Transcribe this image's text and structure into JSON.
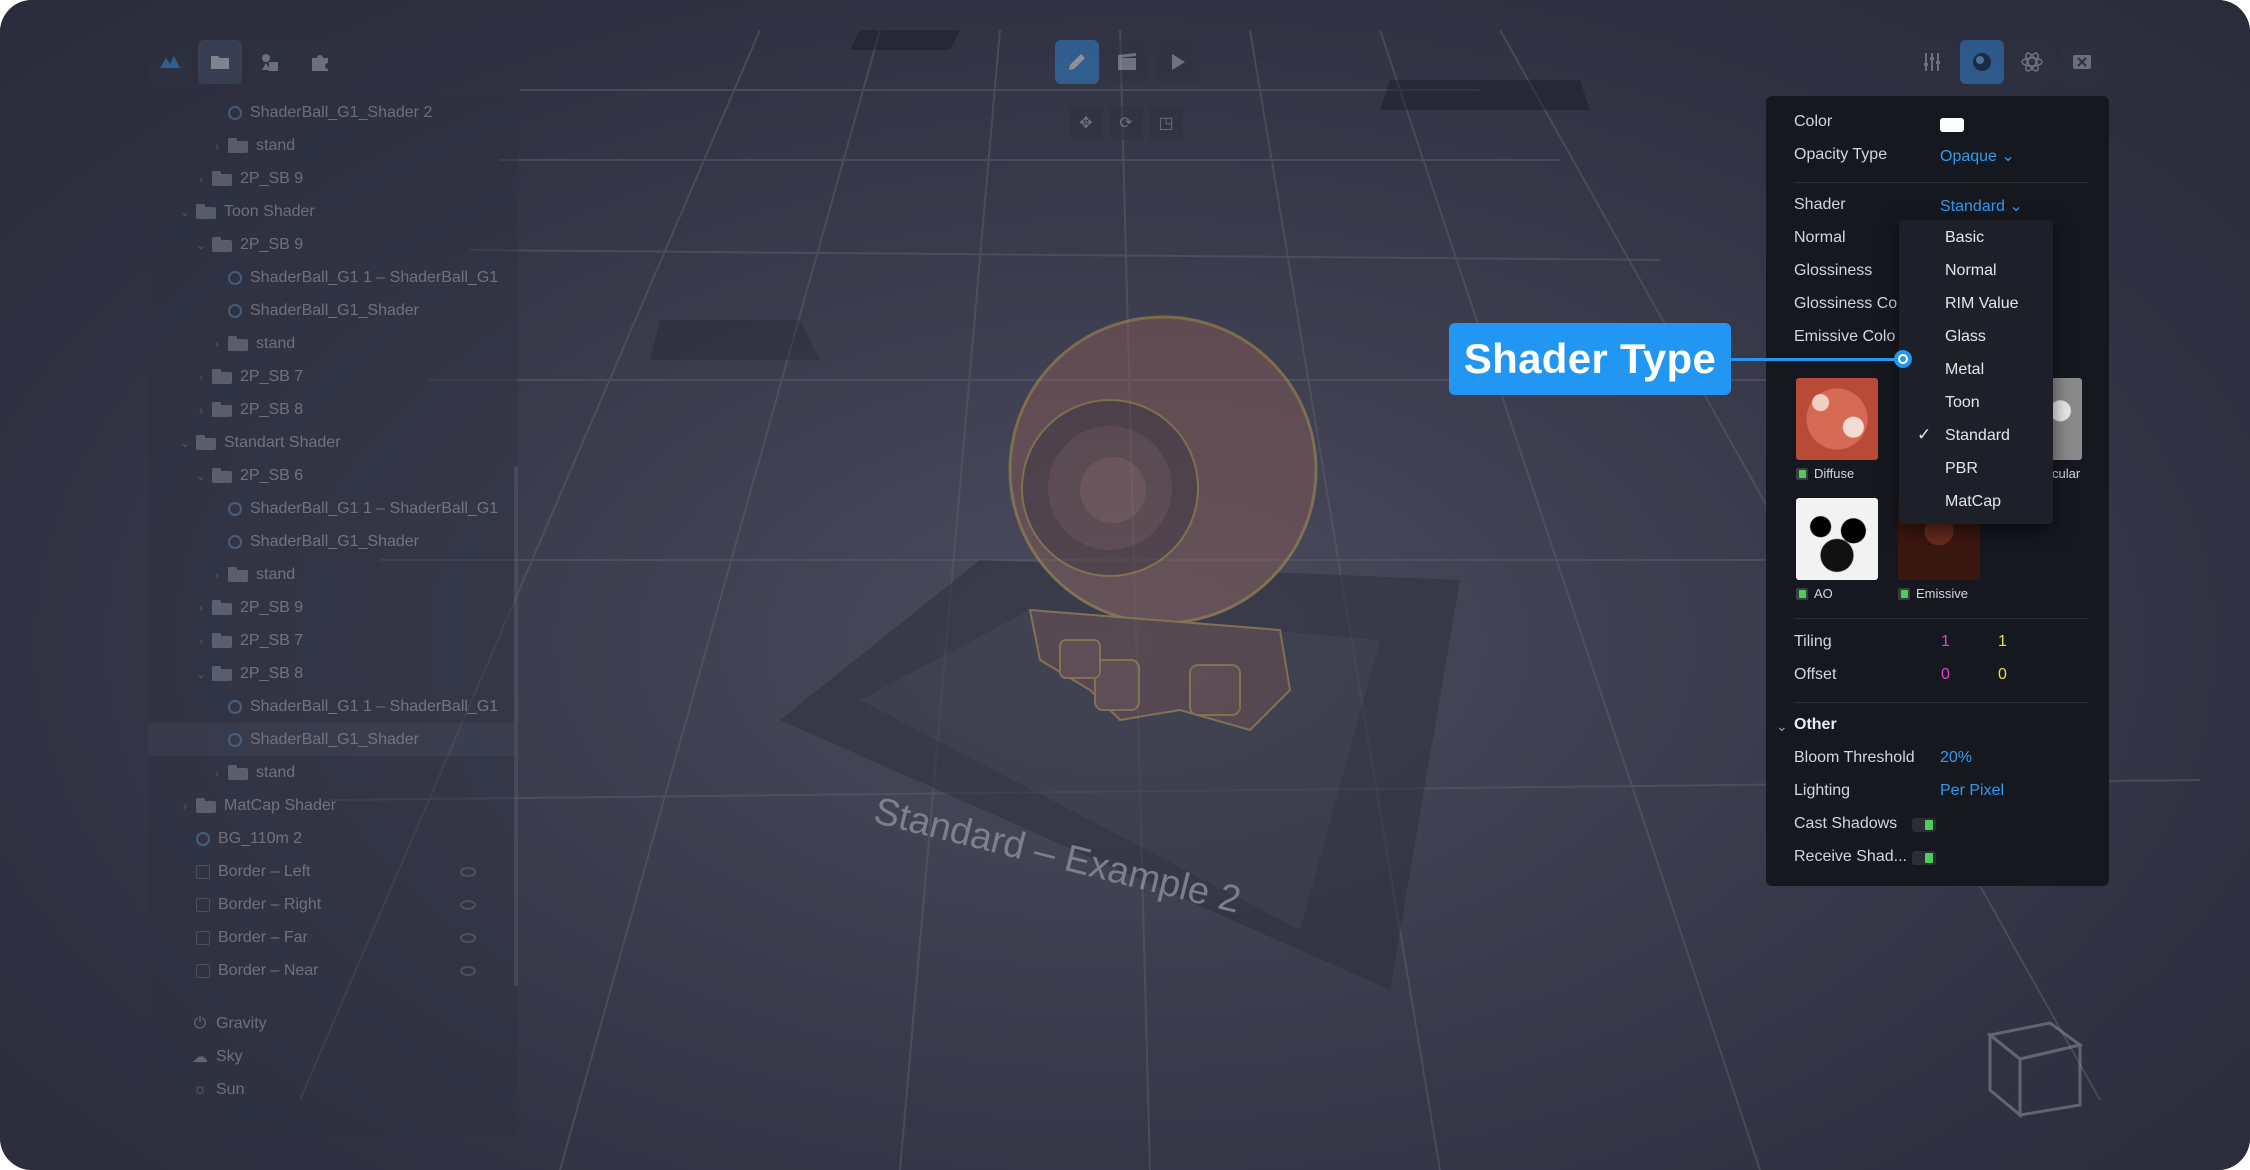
{
  "colors": {
    "accent": "#2196f3",
    "link": "#2f9cf0",
    "tiling_x": "#e040d0",
    "tiling_y": "#e6e03a",
    "toggle_on": "#4fce57"
  },
  "toolbar_left": {
    "icons": [
      "logo-icon",
      "folder-icon",
      "shapes-icon",
      "puzzle-icon"
    ]
  },
  "toolbar_center": {
    "icons": [
      "edit-icon",
      "scene-icon",
      "play-icon"
    ]
  },
  "toolbar_right": {
    "icons": [
      "sliders-icon",
      "material-icon",
      "physics-icon",
      "close-icon"
    ]
  },
  "hierarchy": {
    "items": [
      {
        "label": "ShaderBall_G1_Shader 2",
        "kind": "object",
        "indent": 2
      },
      {
        "label": "stand",
        "kind": "folder",
        "indent": 2,
        "collapsed": true
      },
      {
        "label": "2P_SB 9",
        "kind": "folder",
        "indent": 1,
        "collapsed": true
      },
      {
        "label": "Toon Shader",
        "kind": "folder",
        "indent": 0,
        "collapsed": false
      },
      {
        "label": "2P_SB 9",
        "kind": "folder",
        "indent": 1,
        "collapsed": false
      },
      {
        "label": "ShaderBall_G1 1 – ShaderBall_G1",
        "kind": "object",
        "indent": 2
      },
      {
        "label": "ShaderBall_G1_Shader",
        "kind": "object",
        "indent": 2
      },
      {
        "label": "stand",
        "kind": "folder",
        "indent": 2,
        "collapsed": true
      },
      {
        "label": "2P_SB 7",
        "kind": "folder",
        "indent": 1,
        "collapsed": true
      },
      {
        "label": "2P_SB 8",
        "kind": "folder",
        "indent": 1,
        "collapsed": true
      },
      {
        "label": "Standart Shader",
        "kind": "folder",
        "indent": 0,
        "collapsed": false
      },
      {
        "label": "2P_SB 6",
        "kind": "folder",
        "indent": 1,
        "collapsed": false
      },
      {
        "label": "ShaderBall_G1 1 – ShaderBall_G1",
        "kind": "object",
        "indent": 2
      },
      {
        "label": "ShaderBall_G1_Shader",
        "kind": "object",
        "indent": 2
      },
      {
        "label": "stand",
        "kind": "folder",
        "indent": 2,
        "collapsed": true
      },
      {
        "label": "2P_SB 9",
        "kind": "folder",
        "indent": 1,
        "collapsed": true
      },
      {
        "label": "2P_SB 7",
        "kind": "folder",
        "indent": 1,
        "collapsed": true
      },
      {
        "label": "2P_SB 8",
        "kind": "folder",
        "indent": 1,
        "collapsed": false
      },
      {
        "label": "ShaderBall_G1 1 – ShaderBall_G1",
        "kind": "object",
        "indent": 2
      },
      {
        "label": "ShaderBall_G1_Shader",
        "kind": "object",
        "indent": 2,
        "selected": true
      },
      {
        "label": "stand",
        "kind": "folder",
        "indent": 2,
        "collapsed": true
      },
      {
        "label": "MatCap Shader",
        "kind": "folder",
        "indent": 0,
        "collapsed": true
      },
      {
        "label": "BG_110m 2",
        "kind": "object",
        "indent": 0
      },
      {
        "label": "Border – Left",
        "kind": "check",
        "indent": 0
      },
      {
        "label": "Border – Right",
        "kind": "check",
        "indent": 0
      },
      {
        "label": "Border – Far",
        "kind": "check",
        "indent": 0
      },
      {
        "label": "Border – Near",
        "kind": "check",
        "indent": 0
      }
    ],
    "environment": [
      {
        "label": "Gravity",
        "icon": "gravity-icon"
      },
      {
        "label": "Sky",
        "icon": "cloud-icon"
      },
      {
        "label": "Sun",
        "icon": "sun-icon"
      }
    ]
  },
  "viewport": {
    "stand_label": "Standard – Example 2"
  },
  "properties": {
    "color_label": "Color",
    "opacity_label": "Opacity Type",
    "opacity_value": "Opaque",
    "shader_label": "Shader",
    "shader_value": "Standard",
    "normal_label": "Normal",
    "glossiness_label": "Glossiness",
    "glossiness_color_label": "Glossiness Co",
    "emissive_color_label": "Emissive Colo",
    "textures": {
      "diffuse": "Diffuse",
      "specular": "cular",
      "ao": "AO",
      "emissive": "Emissive"
    },
    "tiling_label": "Tiling",
    "tiling_x": "1",
    "tiling_y": "1",
    "offset_label": "Offset",
    "offset_x": "0",
    "offset_y": "0",
    "other_label": "Other",
    "bloom_label": "Bloom Threshold",
    "bloom_value": "20%",
    "lighting_label": "Lighting",
    "lighting_value": "Per Pixel",
    "cast_label": "Cast Shadows",
    "receive_label": "Receive Shad..."
  },
  "shader_dropdown": {
    "options": [
      "Basic",
      "Normal",
      "RIM Value",
      "Glass",
      "Metal",
      "Toon",
      "Standard",
      "PBR",
      "MatCap"
    ],
    "selected": "Standard"
  },
  "callout": {
    "text": "Shader Type"
  }
}
